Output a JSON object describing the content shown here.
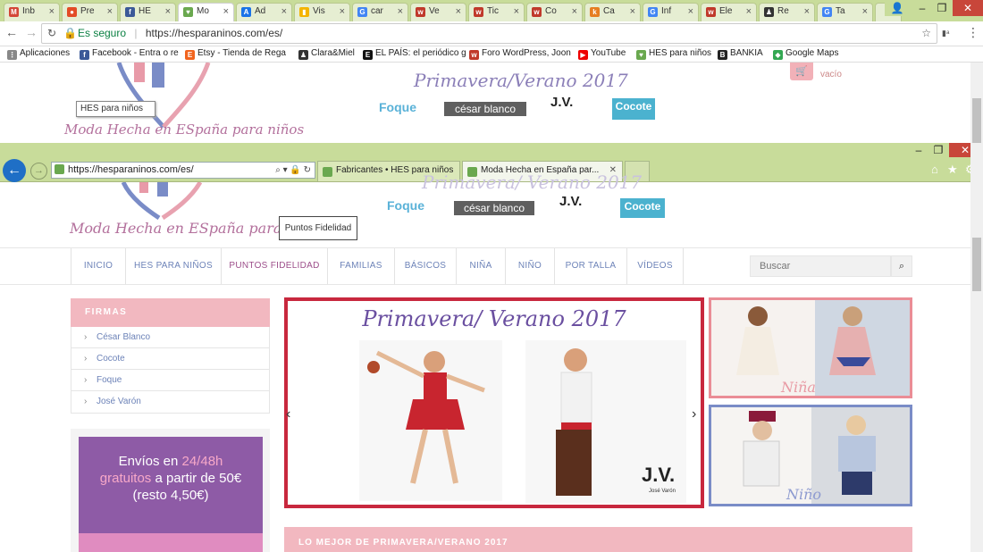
{
  "chrome": {
    "tabs": [
      {
        "label": "Inb",
        "fav": "M",
        "color": "#d44638"
      },
      {
        "label": "Pre",
        "fav": "●",
        "color": "#e34c26"
      },
      {
        "label": "HE",
        "fav": "f",
        "color": "#3b5998"
      },
      {
        "label": "Mo",
        "fav": "♥",
        "color": "#6aa84f",
        "active": true
      },
      {
        "label": "Ad",
        "fav": "A",
        "color": "#1a73e8"
      },
      {
        "label": "Vis",
        "fav": "▮",
        "color": "#f4b400"
      },
      {
        "label": "car",
        "fav": "G",
        "color": "#4285f4"
      },
      {
        "label": "Ve",
        "fav": "w",
        "color": "#c0392b"
      },
      {
        "label": "Tic",
        "fav": "w",
        "color": "#c0392b"
      },
      {
        "label": "Co",
        "fav": "w",
        "color": "#c0392b"
      },
      {
        "label": "Ca",
        "fav": "k",
        "color": "#e67e22"
      },
      {
        "label": "Inf",
        "fav": "G",
        "color": "#4285f4"
      },
      {
        "label": "Ele",
        "fav": "w",
        "color": "#c0392b"
      },
      {
        "label": "Re",
        "fav": "♟",
        "color": "#333"
      },
      {
        "label": "Ta",
        "fav": "G",
        "color": "#4285f4"
      }
    ],
    "secure_label": "Es seguro",
    "url": "https://hesparaninos.com/es/",
    "bookmarks": [
      {
        "label": "Aplicaciones",
        "fav": "⋮",
        "color": "#888"
      },
      {
        "label": "Facebook - Entra o re",
        "fav": "f",
        "color": "#3b5998"
      },
      {
        "label": "Etsy - Tienda de Rega",
        "fav": "E",
        "color": "#f1641e"
      },
      {
        "label": "Clara&Miel",
        "fav": "♟",
        "color": "#333"
      },
      {
        "label": "EL PAÍS: el periódico g",
        "fav": "E",
        "color": "#111"
      },
      {
        "label": "Foro WordPress, Joon",
        "fav": "w",
        "color": "#c0392b"
      },
      {
        "label": "YouTube",
        "fav": "▶",
        "color": "#e00"
      },
      {
        "label": "HES para niños",
        "fav": "♥",
        "color": "#6aa84f"
      },
      {
        "label": "BANKIA",
        "fav": "B",
        "color": "#222"
      },
      {
        "label": "Google Maps",
        "fav": "◆",
        "color": "#34a853"
      }
    ]
  },
  "page_top": {
    "tooltip": "HES para niños",
    "logo_text": "Moda Hecha en ESpaña para niños",
    "banner_title": "Primavera/Verano 2017",
    "brands": [
      "Foque",
      "césar blanco",
      "J.V.",
      "Cocote"
    ],
    "cart_label": "vacío"
  },
  "ie": {
    "url": "https://hesparaninos.com/es/",
    "tabs": [
      "Fabricantes • HES para niños",
      "Moda Hecha en España par..."
    ]
  },
  "site": {
    "logo_text": "Moda Hecha en ESpaña para niños",
    "loyalty_button": "Puntos Fidelidad",
    "banner_title": "Primavera/ Verano 2017",
    "brands": [
      "Foque",
      "césar blanco",
      "J.V.",
      "Cocote"
    ],
    "nav": [
      "INICIO",
      "HES PARA NIÑOS",
      "PUNTOS FIDELIDAD",
      "FAMILIAS",
      "BÁSICOS",
      "NIÑA",
      "NIÑO",
      "POR TALLA",
      "VÍDEOS"
    ],
    "search_placeholder": "Buscar",
    "firmas_title": "FIRMAS",
    "firmas": [
      "César Blanco",
      "Cocote",
      "Foque",
      "José Varón"
    ],
    "promo": {
      "line1": "Envíos en ",
      "hl1": "24/48h",
      "hl2": "gratuitos",
      "line2": " a partir de 50€",
      "line3": "(resto 4,50€)"
    },
    "slider_title": "Primavera/ Verano 2017",
    "slider_brand": "J.V.",
    "slider_brand_sub": "José Varón",
    "tile_girl": "Niña",
    "tile_boy": "Niño",
    "section_title": "LO MEJOR DE PRIMAVERA/VERANO 2017"
  }
}
